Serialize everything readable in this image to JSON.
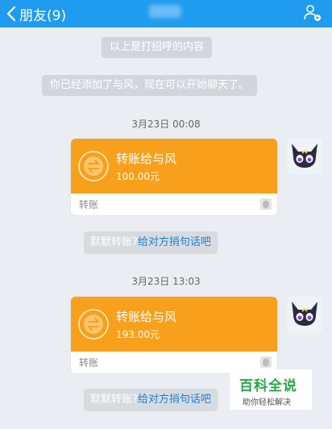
{
  "nav": {
    "back_label": "朋友(9)"
  },
  "system": {
    "greeting_note": "以上是打招呼的内容",
    "added_note": "你已经添加了与风，现在可以开始聊天了。"
  },
  "messages": [
    {
      "time": "3月23日 00:08",
      "title": "转账给与风",
      "amount": "100.00元",
      "label": "转账",
      "hint_question": "默默转账?",
      "hint_link": "给对方捎句话吧"
    },
    {
      "time": "3月23日 13:03",
      "title": "转账给与风",
      "amount": "193.00元",
      "label": "转账",
      "hint_question": "默默转账?",
      "hint_link": "给对方捎句话吧"
    }
  ],
  "watermark": {
    "title": "百科全说",
    "subtitle": "助你轻松解决"
  },
  "colors": {
    "nav": "#1f9cf0",
    "transfer_card": "#f8a01c",
    "link": "#1f7fd3"
  }
}
